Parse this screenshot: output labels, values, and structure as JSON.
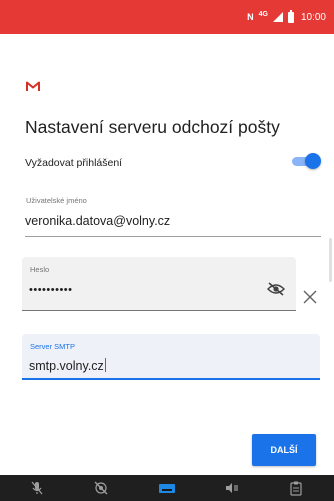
{
  "status_bar": {
    "nfc_label": "N",
    "network_label": "4G",
    "time": "10:00",
    "color": "#e53935"
  },
  "app": {
    "icon": "gmail-icon",
    "title": "Nastavení serveru odchozí pošty"
  },
  "require_login": {
    "label": "Vyžadovat přihlášení",
    "enabled": true
  },
  "username": {
    "label": "Uživatelské jméno",
    "value": "veronika.datova@volny.cz"
  },
  "password": {
    "label": "Heslo",
    "value": "••••••••••"
  },
  "smtp": {
    "label": "Server SMTP",
    "value": "smtp.volny.cz"
  },
  "next_button": {
    "label": "DALŠÍ"
  },
  "bottom_bar": {
    "icons": [
      "mic-off-icon",
      "camera-off-icon",
      "keyboard-icon",
      "volume-icon",
      "clipboard-icon"
    ]
  },
  "colors": {
    "accent": "#1a73e8",
    "gmail_red": "#d93025"
  }
}
